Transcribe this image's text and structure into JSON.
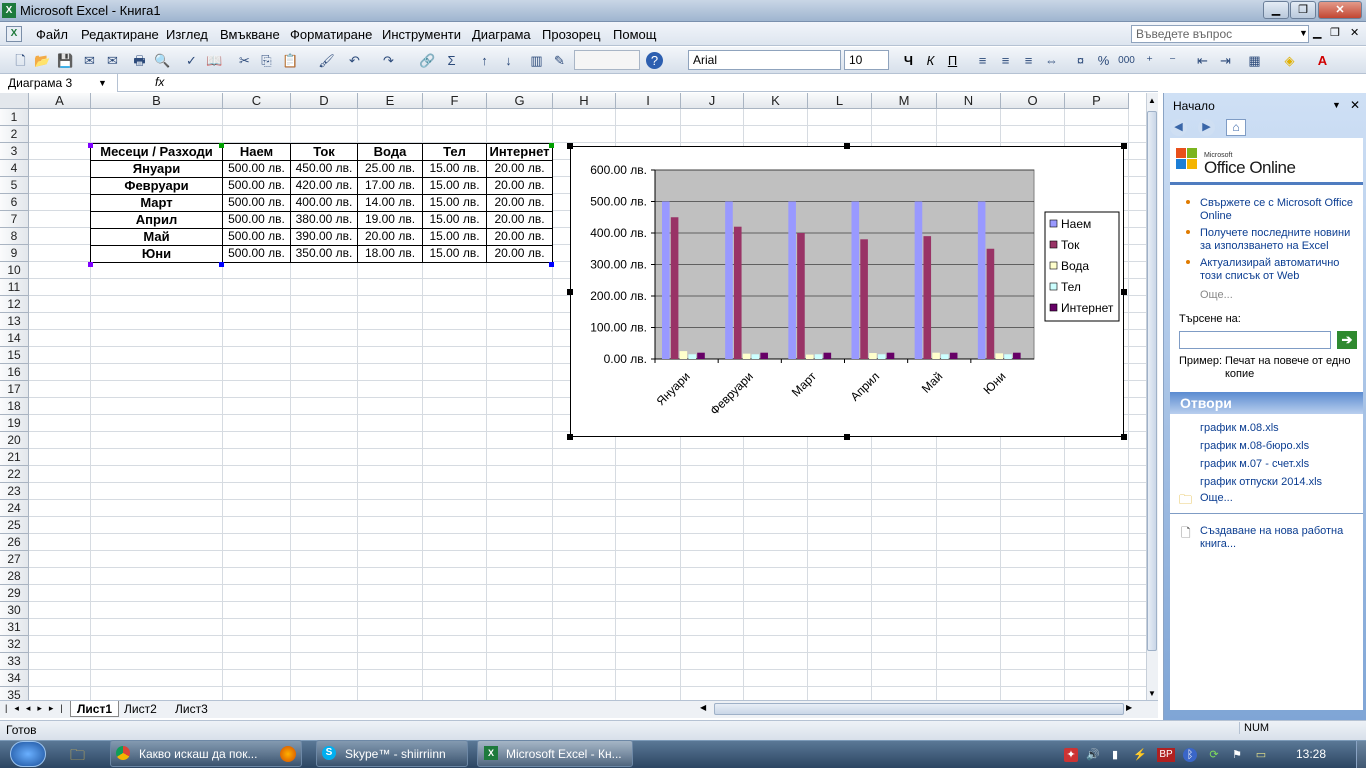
{
  "window": {
    "title": "Microsoft Excel - Книга1",
    "minimize": "▁",
    "restore": "❐",
    "close": "✕"
  },
  "menu": {
    "items": [
      "Файл",
      "Редактиране",
      "Изглед",
      "Вмъкване",
      "Форматиране",
      "Инструменти",
      "Диаграма",
      "Прозорец",
      "Помощ"
    ],
    "help_placeholder": "Въведете въпрос",
    "doc_restore": "❐",
    "doc_close": "✕",
    "doc_min": "▁"
  },
  "toolbar": {
    "font_name": "Arial",
    "font_size": "10",
    "bold": "Ч",
    "italic": "К",
    "underline": "П"
  },
  "formula": {
    "name_box": "Диаграма 3",
    "fx": "fx",
    "content": ""
  },
  "columns": [
    "A",
    "B",
    "C",
    "D",
    "E",
    "F",
    "G",
    "H",
    "I",
    "J",
    "K",
    "L",
    "M",
    "N",
    "O",
    "P"
  ],
  "rows": [
    "1",
    "2",
    "3",
    "4",
    "5",
    "6",
    "7",
    "8",
    "9",
    "10",
    "11",
    "12",
    "13",
    "14",
    "15",
    "16",
    "17",
    "18",
    "19",
    "20",
    "21",
    "22",
    "23",
    "24",
    "25",
    "26",
    "27",
    "28",
    "29",
    "30",
    "31",
    "32",
    "33",
    "34",
    "35"
  ],
  "table": {
    "headers": [
      "Месеци / Разходи",
      "Наем",
      "Ток",
      "Вода",
      "Тел",
      "Интернет"
    ],
    "rows": [
      [
        "Януари",
        "500.00 лв.",
        "450.00 лв.",
        "25.00 лв.",
        "15.00 лв.",
        "20.00 лв."
      ],
      [
        "Февруари",
        "500.00 лв.",
        "420.00 лв.",
        "17.00 лв.",
        "15.00 лв.",
        "20.00 лв."
      ],
      [
        "Март",
        "500.00 лв.",
        "400.00 лв.",
        "14.00 лв.",
        "15.00 лв.",
        "20.00 лв."
      ],
      [
        "Април",
        "500.00 лв.",
        "380.00 лв.",
        "19.00 лв.",
        "15.00 лв.",
        "20.00 лв."
      ],
      [
        "Май",
        "500.00 лв.",
        "390.00 лв.",
        "20.00 лв.",
        "15.00 лв.",
        "20.00 лв."
      ],
      [
        "Юни",
        "500.00 лв.",
        "350.00 лв.",
        "18.00 лв.",
        "15.00 лв.",
        "20.00 лв."
      ]
    ]
  },
  "chart_data": {
    "type": "bar",
    "categories": [
      "Януари",
      "Февруари",
      "Март",
      "Април",
      "Май",
      "Юни"
    ],
    "series": [
      {
        "name": "Наем",
        "values": [
          500,
          500,
          500,
          500,
          500,
          500
        ],
        "color": "#9999ff"
      },
      {
        "name": "Ток",
        "values": [
          450,
          420,
          400,
          380,
          390,
          350
        ],
        "color": "#993366"
      },
      {
        "name": "Вода",
        "values": [
          25,
          17,
          14,
          19,
          20,
          18
        ],
        "color": "#ffffcc"
      },
      {
        "name": "Тел",
        "values": [
          15,
          15,
          15,
          15,
          15,
          15
        ],
        "color": "#ccffff"
      },
      {
        "name": "Интернет",
        "values": [
          20,
          20,
          20,
          20,
          20,
          20
        ],
        "color": "#660066"
      }
    ],
    "ylim": [
      0,
      600
    ],
    "yticks": [
      "0.00 лв.",
      "100.00 лв.",
      "200.00 лв.",
      "300.00 лв.",
      "400.00 лв.",
      "500.00 лв.",
      "600.00 лв."
    ],
    "plot_background": "#c0c0c0",
    "grid": true,
    "legend": "right"
  },
  "sheets": {
    "tabs": [
      "Лист1",
      "Лист2",
      "Лист3"
    ],
    "active": "Лист1"
  },
  "status": {
    "left": "Готов",
    "num": "NUM"
  },
  "taskpane": {
    "title": "Начало",
    "logo_small": "Microsoft",
    "logo": "Office Online",
    "links": [
      "Свържете се с Microsoft Office Online",
      "Получете последните новини за използването на Excel",
      "Актуализирай автоматично този списък от Web"
    ],
    "more": "Още...",
    "search_label": "Търсене на:",
    "search_value": "",
    "example_label": "Пример:",
    "example_text": "Печат на повече от едно копие",
    "open_title": "Отвори",
    "files": [
      "график м.08.xls",
      "график м.08-бюро.xls",
      "график м.07 - счет.xls",
      "график отпуски 2014.xls"
    ],
    "files_more": "Още...",
    "new_workbook": "Създаване на нова работна книга..."
  },
  "taskbar": {
    "tasks": [
      "Какво искаш да пок...",
      "Skype™ - shiirriinn",
      "Microsoft Excel - Кн..."
    ],
    "lang": "BP",
    "clock": "13:28"
  },
  "colors": {
    "accent": "#1e7a3c",
    "selection_handle": "#000000",
    "range_highlight": "#7f00ff"
  }
}
